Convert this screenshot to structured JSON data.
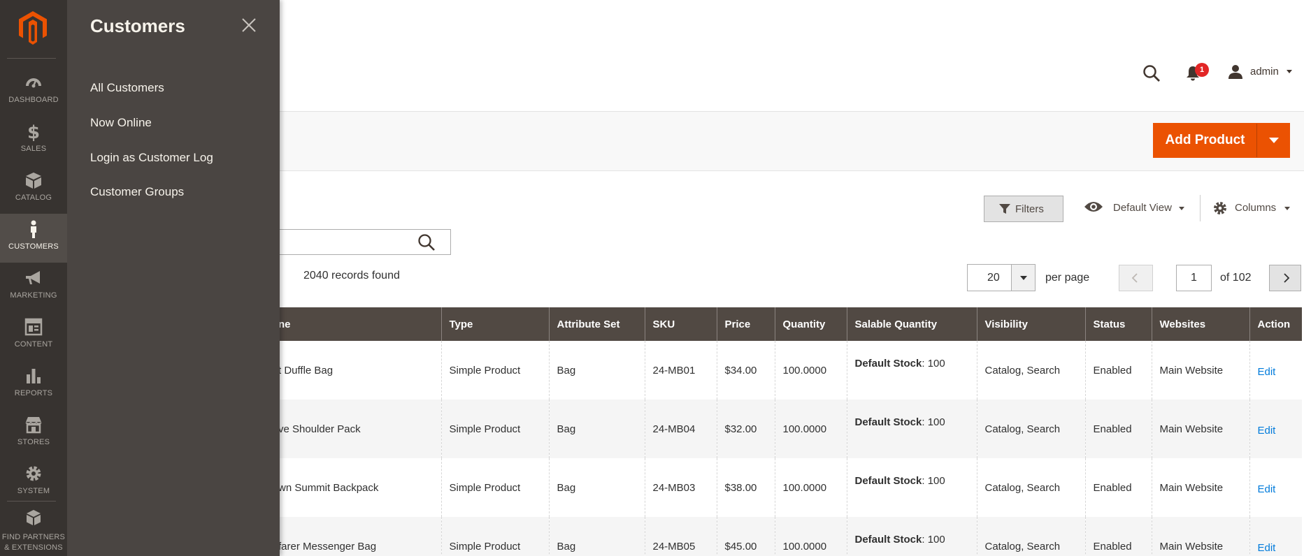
{
  "nav": {
    "items": [
      {
        "id": "dashboard",
        "label": "DASHBOARD",
        "icon": "dashboard-icon"
      },
      {
        "id": "sales",
        "label": "SALES",
        "icon": "dollar-icon"
      },
      {
        "id": "catalog",
        "label": "CATALOG",
        "icon": "box-icon"
      },
      {
        "id": "customers",
        "label": "CUSTOMERS",
        "icon": "person-icon",
        "active": true
      },
      {
        "id": "marketing",
        "label": "MARKETING",
        "icon": "megaphone-icon"
      },
      {
        "id": "content",
        "label": "CONTENT",
        "icon": "layout-icon"
      },
      {
        "id": "reports",
        "label": "REPORTS",
        "icon": "bar-chart-icon"
      },
      {
        "id": "stores",
        "label": "STORES",
        "icon": "store-icon"
      },
      {
        "id": "system",
        "label": "SYSTEM",
        "icon": "gear-icon"
      },
      {
        "id": "partners",
        "label_line1": "FIND PARTNERS",
        "label_line2": "& EXTENSIONS",
        "icon": "cubes-icon"
      }
    ]
  },
  "submenu": {
    "title": "Customers",
    "links": [
      "All Customers",
      "Now Online",
      "Login as Customer Log",
      "Customer Groups"
    ]
  },
  "header": {
    "notification_count": "1",
    "user_name": "admin"
  },
  "actions": {
    "add_product_label": "Add Product"
  },
  "toolbar": {
    "filters_label": "Filters",
    "default_view_label": "Default View",
    "columns_label": "Columns",
    "keyword_search_value": "",
    "records_found": "2040 records found",
    "per_page_value": "20",
    "per_page_label": "per page",
    "current_page": "1",
    "of_pages": "of 102"
  },
  "grid": {
    "columns": [
      "ne",
      "Type",
      "Attribute Set",
      "SKU",
      "Price",
      "Quantity",
      "Salable Quantity",
      "Visibility",
      "Status",
      "Websites",
      "Action"
    ],
    "rows": [
      {
        "name": "t Duffle Bag",
        "type": "Simple Product",
        "attribute_set": "Bag",
        "sku": "24-MB01",
        "price": "$34.00",
        "quantity": "100.0000",
        "stock_label": "Default Stock",
        "stock_value": ": 100",
        "visibility": "Catalog, Search",
        "status": "Enabled",
        "websites": "Main Website",
        "action": "Edit"
      },
      {
        "name": "ve Shoulder Pack",
        "type": "Simple Product",
        "attribute_set": "Bag",
        "sku": "24-MB04",
        "price": "$32.00",
        "quantity": "100.0000",
        "stock_label": "Default Stock",
        "stock_value": ": 100",
        "visibility": "Catalog, Search",
        "status": "Enabled",
        "websites": "Main Website",
        "action": "Edit"
      },
      {
        "name": "wn Summit Backpack",
        "type": "Simple Product",
        "attribute_set": "Bag",
        "sku": "24-MB03",
        "price": "$38.00",
        "quantity": "100.0000",
        "stock_label": "Default Stock",
        "stock_value": ": 100",
        "visibility": "Catalog, Search",
        "status": "Enabled",
        "websites": "Main Website",
        "action": "Edit"
      },
      {
        "name": "farer Messenger Bag",
        "type": "Simple Product",
        "attribute_set": "Bag",
        "sku": "24-MB05",
        "price": "$45.00",
        "quantity": "100.0000",
        "stock_label": "Default Stock",
        "stock_value": ": 100",
        "visibility": "Catalog, Search",
        "status": "Enabled",
        "websites": "Main Website",
        "action": "Edit"
      }
    ]
  },
  "colors": {
    "nav_bg": "#373330",
    "submenu_bg": "#4a4542",
    "accent": "#eb5202",
    "grid_header": "#514943",
    "link": "#007bdb"
  }
}
